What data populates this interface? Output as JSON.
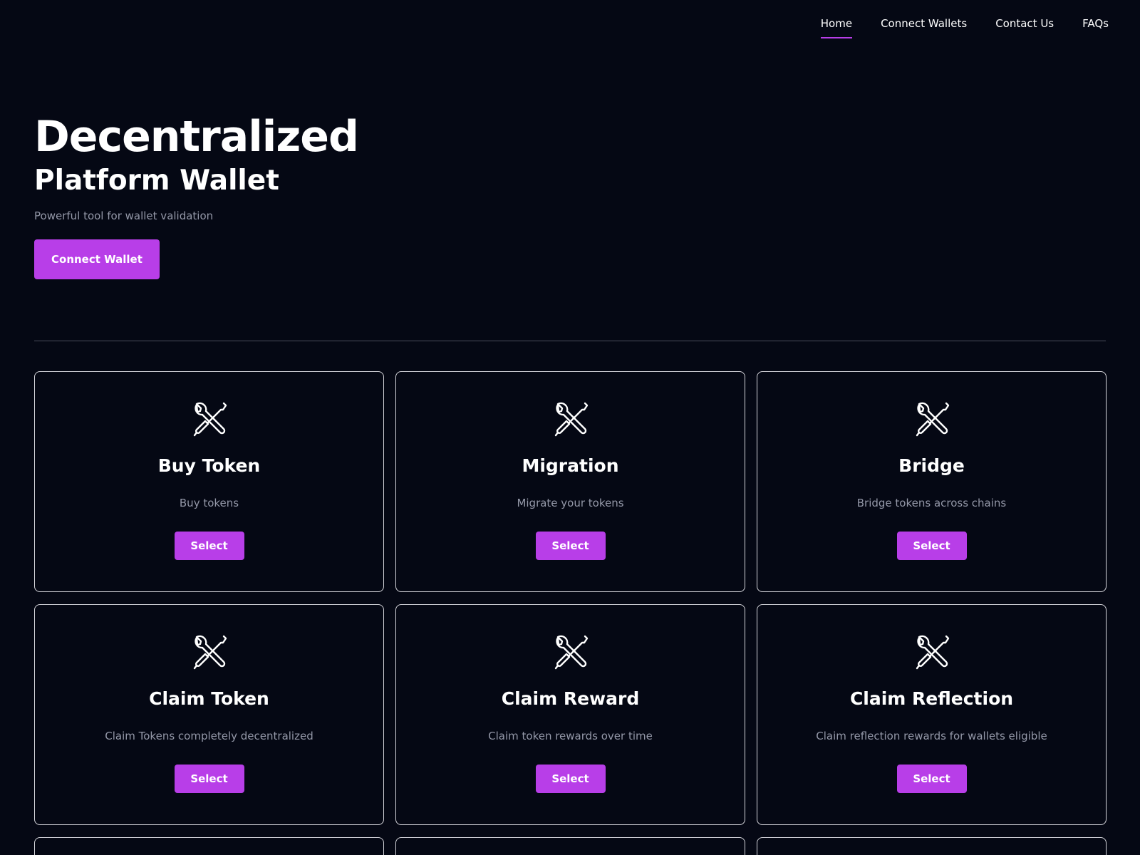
{
  "nav": {
    "items": [
      {
        "label": "Home",
        "active": true
      },
      {
        "label": "Connect Wallets",
        "active": false
      },
      {
        "label": "Contact Us",
        "active": false
      },
      {
        "label": "FAQs",
        "active": false
      }
    ]
  },
  "hero": {
    "title": "Decentralized",
    "subtitle": "Platform Wallet",
    "tagline": "Powerful tool for wallet validation",
    "cta_label": "Connect Wallet"
  },
  "cards": [
    {
      "title": "Buy Token",
      "description": "Buy tokens",
      "button": "Select",
      "icon": "tools-icon"
    },
    {
      "title": "Migration",
      "description": "Migrate your tokens",
      "button": "Select",
      "icon": "tools-icon"
    },
    {
      "title": "Bridge",
      "description": "Bridge tokens across chains",
      "button": "Select",
      "icon": "tools-icon"
    },
    {
      "title": "Claim Token",
      "description": "Claim Tokens completely decentralized",
      "button": "Select",
      "icon": "tools-icon"
    },
    {
      "title": "Claim Reward",
      "description": "Claim token rewards over time",
      "button": "Select",
      "icon": "tools-icon"
    },
    {
      "title": "Claim Reflection",
      "description": "Claim reflection rewards for wallets eligible",
      "button": "Select",
      "icon": "tools-icon"
    }
  ],
  "colors": {
    "background": "#050814",
    "accent": "#b83ee8",
    "muted_text": "#9498a8",
    "card_border": "#d6d6dc"
  }
}
